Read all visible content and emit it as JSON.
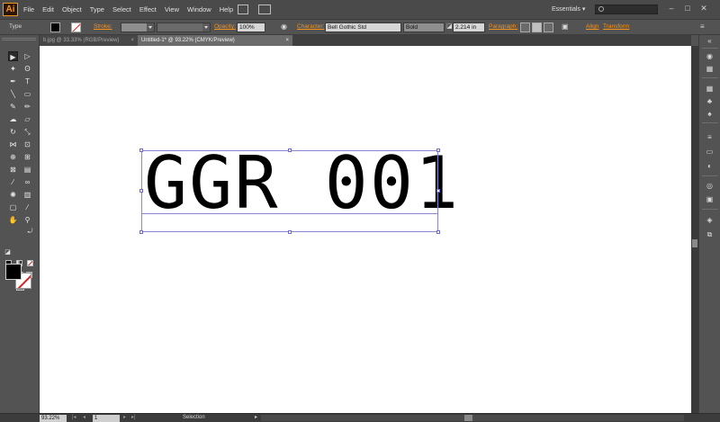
{
  "app": {
    "logo": "Ai"
  },
  "menubar": {
    "menus": [
      "File",
      "Edit",
      "Object",
      "Type",
      "Select",
      "Effect",
      "View",
      "Window",
      "Help"
    ],
    "workspace": "Essentials",
    "workspace_arrow": "▾",
    "window_controls": {
      "minimize": "–",
      "maximize": "□",
      "close": "✕"
    }
  },
  "controlbar": {
    "selection_type": "Type",
    "stroke_label": "Stroke:",
    "opacity_label": "Opacity:",
    "opacity_value": "100%",
    "character_label": "Character:",
    "font_family": "Bell Gothic Std",
    "font_style": "Bold",
    "font_size": "2.214 in",
    "paragraph_label": "Paragraph:",
    "align_label": "Align",
    "transform_label": "Transform"
  },
  "tabs": [
    {
      "label": "b.jpg @ 33.33% (RGB/Preview)",
      "close": "×"
    },
    {
      "label": "Untitled-1* @ 93.22% (CMYK/Preview)",
      "close": "×"
    }
  ],
  "canvas": {
    "text": "GGR 001"
  },
  "statusbar": {
    "zoom": "93.22%",
    "page": "1",
    "nav_first": "|◂",
    "nav_prev": "◂",
    "nav_next": "▸",
    "nav_last": "▸|",
    "status": "Selection",
    "status_arrow": "▸"
  },
  "icons": {
    "selection": "▶",
    "direct_selection": "▷",
    "magic_wand": "✦",
    "lasso": "ʘ",
    "pen": "✒",
    "type": "T",
    "line": "╲",
    "rectangle": "▭",
    "paintbrush": "✎",
    "pencil": "✏",
    "blob_brush": "☁",
    "eraser": "▱",
    "rotate": "↻",
    "scale": "⤡",
    "width": "⋈",
    "free_transform": "⊡",
    "shape_builder": "⊕",
    "perspective": "⊞",
    "mesh": "⊠",
    "gradient": "▤",
    "eyedropper": "⁄",
    "blend": "∞",
    "symbol_sprayer": "✺",
    "column_graph": "▥",
    "artboard": "▢",
    "slice": "⁄",
    "hand": "✋",
    "zoom": "⚲",
    "swap": "⤾",
    "default_colors": "◪",
    "color_mode": "■",
    "gradient_mode": "▦",
    "none_mode": "⧄",
    "draw_normal": "◘",
    "draw_behind": "◙",
    "draw_inside": "◚",
    "screen_mode": "⊟",
    "rd_collapse": "«",
    "rd_color": "◉",
    "rd_color_guide": "▦",
    "rd_swatches": "▦",
    "rd_brushes": "♣",
    "rd_symbols": "♠",
    "rd_stroke": "≡",
    "rd_gradient": "▭",
    "rd_transparency": "◐",
    "rd_appearance": "◎",
    "rd_graphic_styles": "▣",
    "rd_layers": "◈",
    "rd_artboards": "⧉"
  },
  "colors": {
    "accent": "#f7941d",
    "selection_box": "#8a86d6",
    "fill": "#000000",
    "stroke_none": "#e02020"
  }
}
